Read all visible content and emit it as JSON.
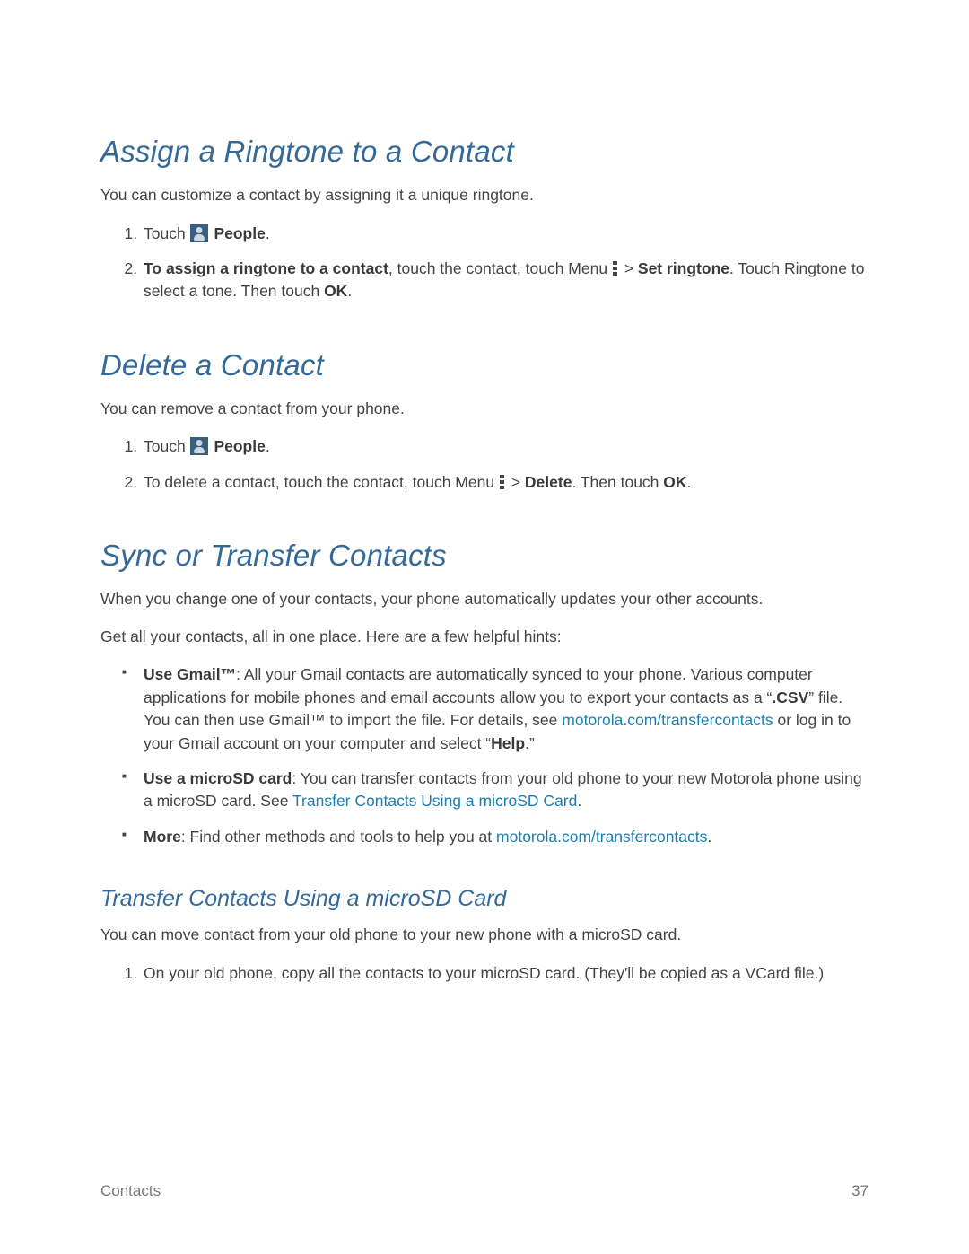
{
  "sections": {
    "ringtone": {
      "heading": "Assign a Ringtone to a Contact",
      "intro": "You can customize a contact by assigning it a unique ringtone.",
      "step1_touch": "Touch ",
      "step1_people": "People",
      "step2_bold_lead": "To assign a ringtone to a contact",
      "step2_after_lead": ", touch the contact, touch Menu ",
      "step2_gt": " > ",
      "step2_set_ringtone": "Set ringtone",
      "step2_tail1": ". Touch Ringtone to select a tone. Then touch ",
      "step2_ok": "OK",
      "step2_tail2": "."
    },
    "delete": {
      "heading": "Delete a Contact",
      "intro": "You can remove a contact from your phone.",
      "step1_touch": "Touch ",
      "step1_people": "People",
      "step2_lead": "To delete a contact, touch the contact, touch Menu ",
      "step2_gt": " > ",
      "step2_delete": "Delete",
      "step2_tail1": ". Then touch ",
      "step2_ok": "OK",
      "step2_tail2": "."
    },
    "sync": {
      "heading": "Sync or Transfer Contacts",
      "p1": "When you change one of your contacts, your phone automatically updates your other accounts.",
      "p2": "Get all your contacts, all in one place. Here are a few helpful hints:",
      "b1_lead": "Use Gmail™",
      "b1_after_lead": ": All your Gmail contacts are automatically synced to your phone. Various computer applications for mobile phones and email accounts allow you to export your contacts as a “",
      "b1_csv": ".CSV",
      "b1_after_csv": "” file. You can then use Gmail™ to import the file. For details, see ",
      "b1_link": "motorola.com/transfercontacts",
      "b1_after_link": " or log in to your Gmail account on your computer and select “",
      "b1_help": "Help",
      "b1_tail": ".”",
      "b2_lead": "Use a microSD card",
      "b2_after_lead": ": You can transfer contacts from your old phone to your new Motorola phone using a microSD card. See ",
      "b2_link": "Transfer Contacts Using a microSD Card",
      "b2_tail": ".",
      "b3_lead": "More",
      "b3_after_lead": ": Find other methods and tools to help you at ",
      "b3_link": "motorola.com/transfercontacts",
      "b3_tail": "."
    },
    "transfer": {
      "heading": "Transfer Contacts Using a microSD Card",
      "intro": "You can move contact from your old phone to your new phone with a microSD card.",
      "step1": "On your old phone, copy all the contacts to your microSD card. (They'll be copied as a VCard file.)"
    }
  },
  "footer": {
    "left": "Contacts",
    "right": "37"
  }
}
